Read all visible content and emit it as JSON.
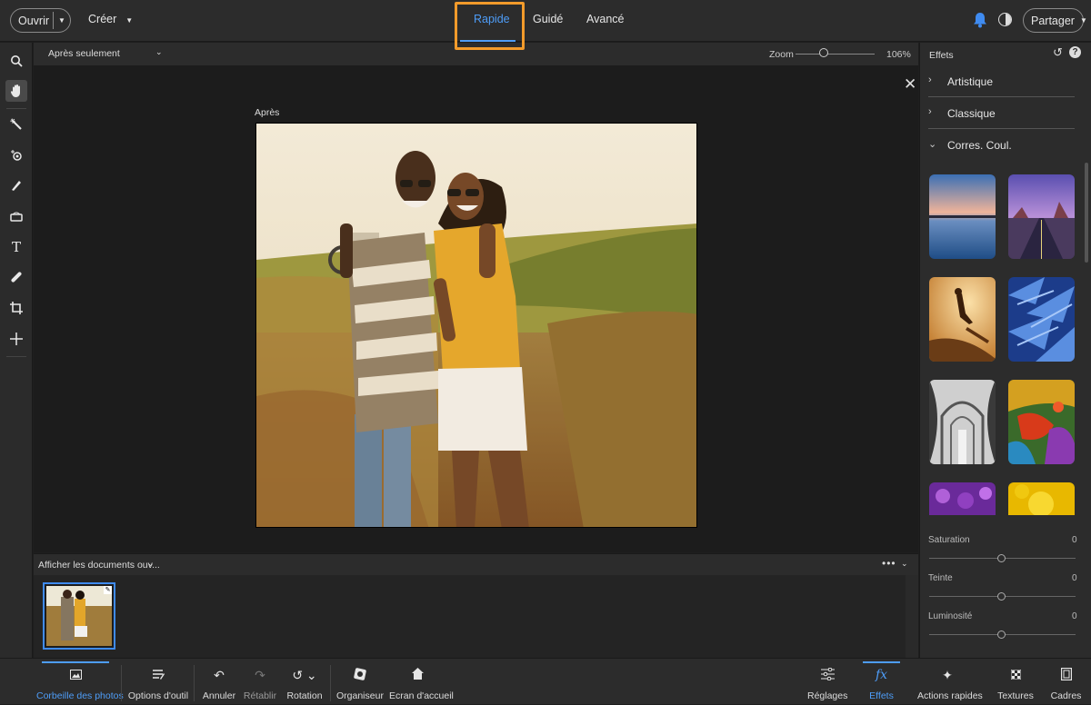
{
  "topbar": {
    "open_label": "Ouvrir",
    "create_label": "Créer",
    "tabs": [
      {
        "label": "Rapide",
        "active": true
      },
      {
        "label": "Guidé",
        "active": false
      },
      {
        "label": "Avancé",
        "active": false
      }
    ],
    "share_label": "Partager",
    "icons": [
      "bell-icon",
      "theme-contrast-icon"
    ]
  },
  "tools": [
    "zoom-icon",
    "hand-icon",
    "quick-selection-icon",
    "red-eye-icon",
    "whiten-teeth-icon",
    "sponge-icon",
    "type-icon",
    "spot-healing-icon",
    "crop-icon",
    "move-icon"
  ],
  "canvas": {
    "view_select": "Après seulement",
    "zoom_label": "Zoom",
    "zoom_value": "106%",
    "zoom_level": 0.36,
    "after_label": "Après"
  },
  "photo_bin": {
    "select_label": "Afficher les documents ouv..."
  },
  "effects_panel": {
    "title": "Effets",
    "categories": [
      {
        "label": "Artistique",
        "expanded": false
      },
      {
        "label": "Classique",
        "expanded": false
      },
      {
        "label": "Corres. Coul.",
        "expanded": true
      }
    ],
    "thumbnails": [
      "lake-sunset",
      "desert-road",
      "skateboarder",
      "blue-feathers",
      "cathedral-arches",
      "colorful-painting",
      "purple-flowers",
      "yellow-flower"
    ],
    "sliders": [
      {
        "label": "Saturation",
        "value": "0"
      },
      {
        "label": "Teinte",
        "value": "0"
      },
      {
        "label": "Luminosité",
        "value": "0"
      }
    ]
  },
  "bottombar": {
    "items": [
      {
        "label": "Corbeille des photos",
        "icon": "photo-bin-icon",
        "active": true
      },
      {
        "label": "Options d'outil",
        "icon": "tool-options-icon"
      },
      {
        "label": "Annuler",
        "icon": "undo-icon"
      },
      {
        "label": "Rétablir",
        "icon": "redo-icon"
      },
      {
        "label": "Rotation",
        "icon": "rotate-icon"
      },
      {
        "label": "Organiseur",
        "icon": "organizer-icon"
      },
      {
        "label": "Ecran d'accueil",
        "icon": "home-icon"
      },
      {
        "label": "Réglages",
        "icon": "adjustments-icon"
      },
      {
        "label": "Effets",
        "icon": "fx-icon",
        "active": true
      },
      {
        "label": "Actions rapides",
        "icon": "quick-actions-icon"
      },
      {
        "label": "Textures",
        "icon": "textures-icon"
      },
      {
        "label": "Cadres",
        "icon": "frames-icon"
      }
    ]
  },
  "colors": {
    "accent": "#4e9df8",
    "highlight": "#f39b2b",
    "panel": "#2c2c2c",
    "canvas": "#1c1c1c"
  }
}
